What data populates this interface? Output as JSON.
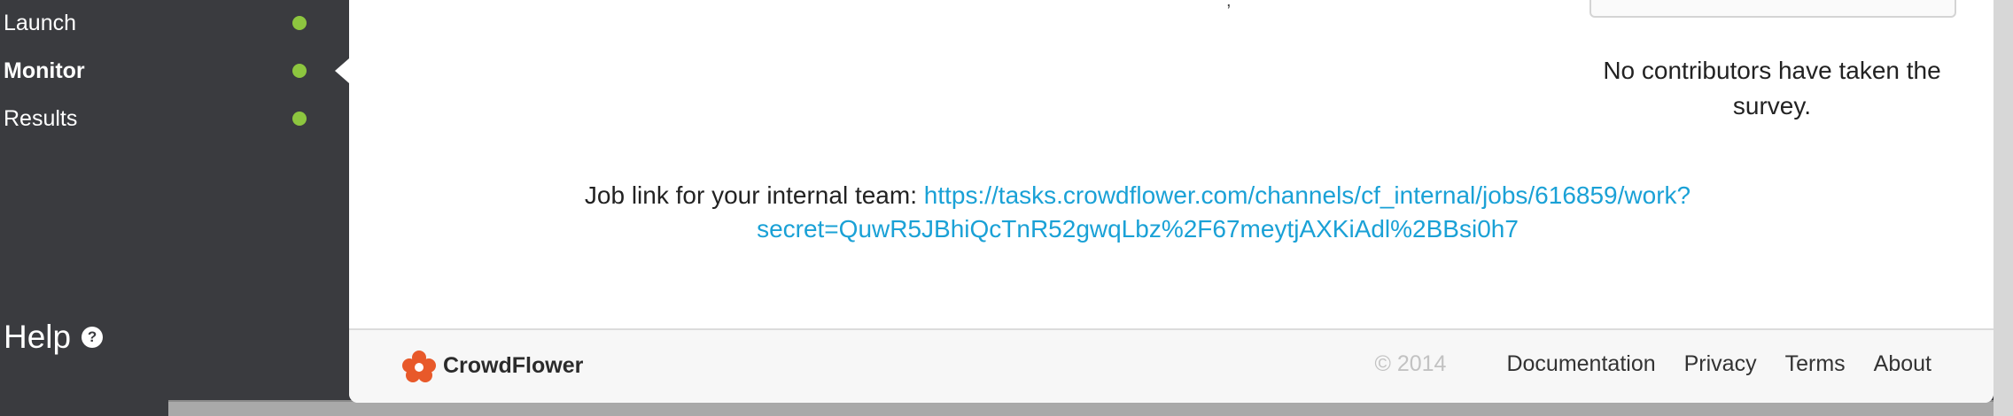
{
  "sidebar": {
    "items": [
      {
        "label": "Launch",
        "active": false,
        "status_color": "#8dc63f"
      },
      {
        "label": "Monitor",
        "active": true,
        "status_color": "#8dc63f"
      },
      {
        "label": "Results",
        "active": false,
        "status_color": "#8dc63f"
      }
    ],
    "help_label": "Help",
    "help_icon": "question-circle-icon"
  },
  "main": {
    "no_contributors_text": "No contributors have taken the survey.",
    "job_link_label": "Job link for your internal team:",
    "job_link_url": "https://tasks.crowdflower.com/channels/cf_internal/jobs/616859/work?secret=QuwR5JBhiQcTnR52gwqLbz%2F67meytjAXKiAdl%2BBsi0h7",
    "job_link_url_line1": "https://tasks.crowdflower.com/channels/cf_internal/jobs/616859/work?",
    "job_link_url_line2": "secret=QuwR5JBhiQcTnR52gwqLbz%2F67meytjAXKiAdl%2BBsi0h7"
  },
  "footer": {
    "brand_name": "CrowdFlower",
    "brand_icon": "crowdflower-logo",
    "brand_color": "#e8592a",
    "copyright": "© 2014",
    "links": [
      "Documentation",
      "Privacy",
      "Terms",
      "About"
    ]
  },
  "colors": {
    "sidebar_bg": "#3a3b3f",
    "link": "#1aa1d6",
    "status_dot": "#8dc63f"
  }
}
